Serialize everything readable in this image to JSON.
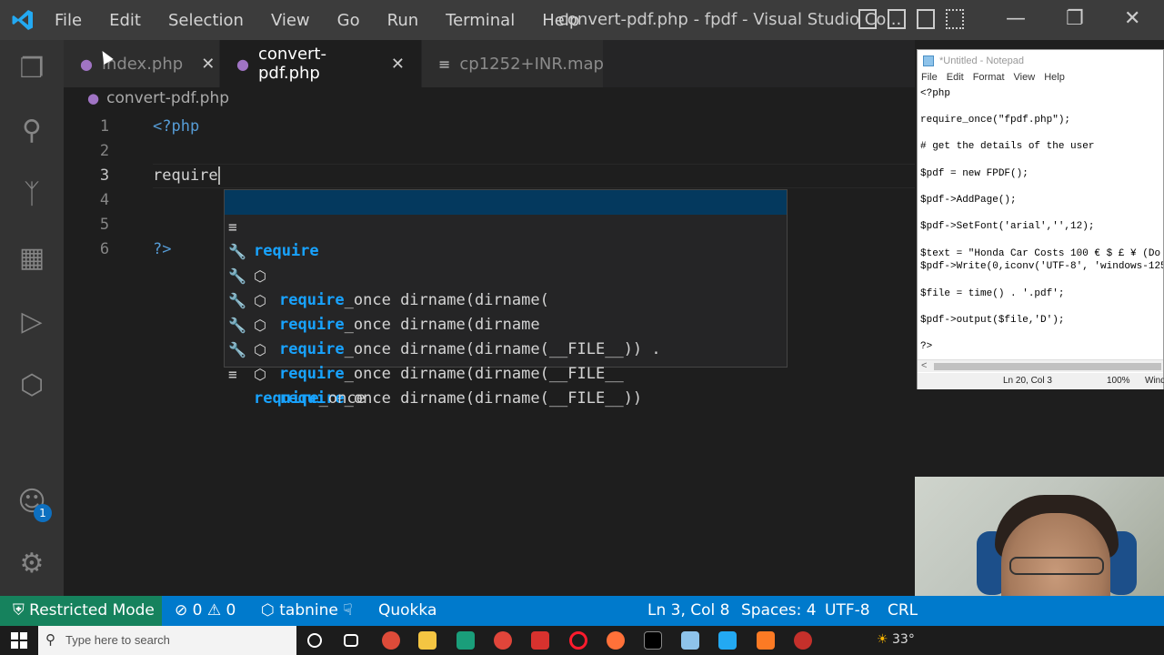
{
  "titlebar": {
    "menu": [
      "File",
      "Edit",
      "Selection",
      "View",
      "Go",
      "Run",
      "Terminal",
      "Help"
    ],
    "title": "convert-pdf.php - fpdf - Visual Studio Co..."
  },
  "tabs": [
    {
      "label": "index.php",
      "icon": "php-elephant-icon"
    },
    {
      "label": "convert-pdf.php",
      "icon": "php-elephant-icon",
      "active": true
    },
    {
      "label": "cp1252+INR.map",
      "icon": "lines-icon"
    }
  ],
  "breadcrumb": "convert-pdf.php",
  "editor": {
    "lines": [
      {
        "num": "1",
        "text": "<?php"
      },
      {
        "num": "2",
        "text": ""
      },
      {
        "num": "3",
        "text": "require"
      },
      {
        "num": "4",
        "text": ""
      },
      {
        "num": "5",
        "text": ""
      },
      {
        "num": "6",
        "text": "?>"
      }
    ]
  },
  "suggestions": [
    {
      "match": "require",
      "rest": "",
      "kind": "keyword"
    },
    {
      "match": "require",
      "rest": "_once dirname(dirname(",
      "kind": "snippet"
    },
    {
      "match": "require",
      "rest": "_once dirname(dirname",
      "kind": "snippet"
    },
    {
      "match": "require",
      "rest": "_once dirname(dirname(__FILE__)) .",
      "kind": "snippet"
    },
    {
      "match": "require",
      "rest": "_once dirname(dirname(__FILE__",
      "kind": "snippet"
    },
    {
      "match": "require",
      "rest": "_once dirname(dirname(__FILE__))",
      "kind": "snippet"
    },
    {
      "match": "require",
      "rest": "_once",
      "kind": "keyword"
    }
  ],
  "notepad": {
    "title": "*Untitled - Notepad",
    "menu": [
      "File",
      "Edit",
      "Format",
      "View",
      "Help"
    ],
    "lines": [
      "<?php",
      "",
      "require_once(\"fpdf.php\");",
      "",
      "# get the details of the user",
      "",
      "$pdf = new FPDF();",
      "",
      "$pdf->AddPage();",
      "",
      "$pdf->SetFont('arial','',12);",
      "",
      "$text = \"Honda Car Costs 100 € $ £ ¥ (Do",
      "$pdf->Write(0,iconv('UTF-8', 'windows-125",
      "",
      "$file = time() . '.pdf';",
      "",
      "$pdf->output($file,'D');",
      "",
      "?>"
    ],
    "scroll_left": "<",
    "status": {
      "position": "Ln 20, Col 3",
      "zoom": "100%",
      "eol": "Wind"
    }
  },
  "statusbar": {
    "restricted": "Restricted Mode",
    "errors": "0",
    "warnings": "0",
    "tabnine": "tabnine",
    "quokka": "Quokka",
    "position": "Ln 3, Col 8",
    "spaces": "Spaces: 4",
    "encoding": "UTF-8",
    "eol": "CRL"
  },
  "activity": {
    "badge": "1"
  },
  "taskbar": {
    "search_placeholder": "Type here to search",
    "temp": "33°"
  }
}
